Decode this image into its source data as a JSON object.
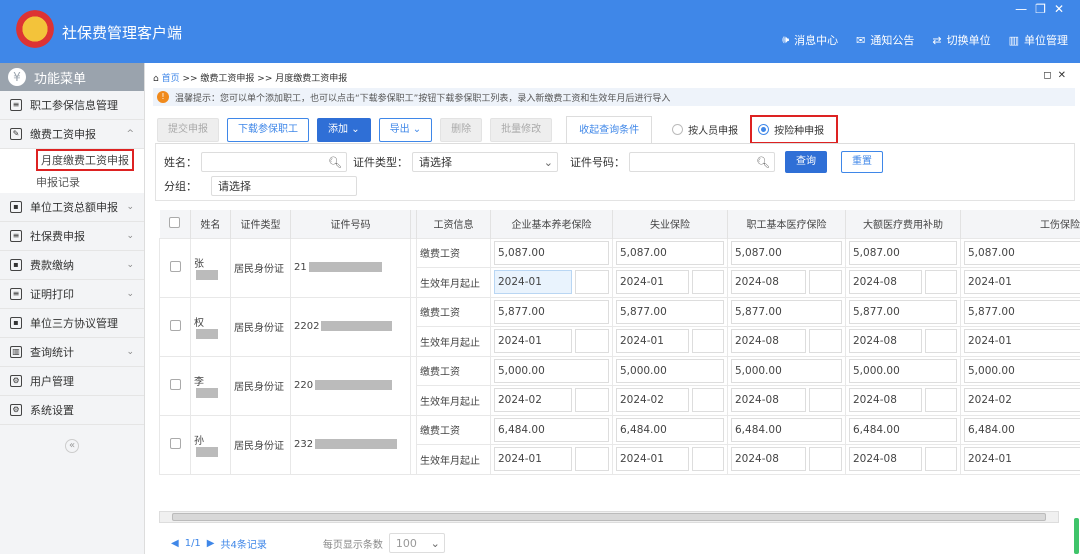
{
  "header": {
    "title": "社保费管理客户端",
    "window_controls": [
      "—",
      "❐",
      "✕"
    ],
    "nav": [
      {
        "icon": "speaker-icon",
        "glyph": "🕪",
        "label": "消息中心"
      },
      {
        "icon": "mail-icon",
        "glyph": "✉",
        "label": "通知公告"
      },
      {
        "icon": "switch-icon",
        "glyph": "⇄",
        "label": "切换单位"
      },
      {
        "icon": "building-icon",
        "glyph": "▥",
        "label": "单位管理"
      }
    ]
  },
  "sidebar": {
    "title": "功能菜单",
    "items": [
      {
        "label": "职工参保信息管理",
        "glyph": "≡"
      },
      {
        "label": "缴费工资申报",
        "glyph": "✎",
        "chev": "^",
        "subs": [
          "月度缴费工资申报",
          "申报记录"
        ]
      },
      {
        "label": "单位工资总额申报",
        "glyph": "▪",
        "chev": "⌄"
      },
      {
        "label": "社保费申报",
        "glyph": "≡",
        "chev": "⌄"
      },
      {
        "label": "费款缴纳",
        "glyph": "▪",
        "chev": "⌄"
      },
      {
        "label": "证明打印",
        "glyph": "≡",
        "chev": "⌄"
      },
      {
        "label": "单位三方协议管理",
        "glyph": "▪"
      },
      {
        "label": "查询统计",
        "glyph": "▥",
        "chev": "⌄"
      },
      {
        "label": "用户管理",
        "glyph": "⚙"
      },
      {
        "label": "系统设置",
        "glyph": "⚙"
      }
    ],
    "collapse": "«"
  },
  "breadcrumb": {
    "home": "首页",
    "sep": " >> ",
    "items": [
      "缴费工资申报",
      "月度缴费工资申报"
    ]
  },
  "tip": "温馨提示：您可以单个添加职工，也可以点击“下载参保职工”按钮下载参保职工列表，录入新缴费工资和生效年月后进行导入",
  "toolbar": {
    "submit": "提交申报",
    "download": "下载参保职工",
    "add": "添加",
    "export": "导出",
    "delete": "删除",
    "batch": "批量修改",
    "collapse_query": "收起查询条件",
    "radio_person": "按人员申报",
    "radio_insurance": "按险种申报"
  },
  "query": {
    "name_label": "姓名：",
    "name_value": "",
    "idtype_label": "证件类型：",
    "idtype_value": "请选择",
    "idno_label": "证件号码：",
    "idno_value": "",
    "group_label": "分组：",
    "group_value": "请选择",
    "search": "查询",
    "reset": "重置"
  },
  "table": {
    "headers": [
      "姓名",
      "证件类型",
      "证件号码",
      "工资信息",
      "企业基本养老保险",
      "失业保险",
      "职工基本医疗保险",
      "大额医疗费用补助",
      "工伤保险"
    ],
    "row_labels": [
      "缴费工资",
      "生效年月起止"
    ],
    "rows": [
      {
        "name": "张",
        "idtype": "居民身份证",
        "idno": "21",
        "wage": "5,087.00",
        "dates": [
          "2024-01",
          "2024-01",
          "2024-08",
          "2024-08",
          "2024-01"
        ]
      },
      {
        "name": "权",
        "idtype": "居民身份证",
        "idno": "2202",
        "wage": "5,877.00",
        "dates": [
          "2024-01",
          "2024-01",
          "2024-08",
          "2024-08",
          "2024-01"
        ]
      },
      {
        "name": "李",
        "idtype": "居民身份证",
        "idno": "220",
        "wage": "5,000.00",
        "dates": [
          "2024-02",
          "2024-02",
          "2024-08",
          "2024-08",
          "2024-02"
        ]
      },
      {
        "name": "孙",
        "idtype": "居民身份证",
        "idno": "232",
        "wage": "6,484.00",
        "dates": [
          "2024-01",
          "2024-01",
          "2024-08",
          "2024-08",
          "2024-01"
        ]
      }
    ]
  },
  "pager": {
    "page": "1/1",
    "total": "共4条记录",
    "per_page_label": "每页显示条数",
    "per_page": "100"
  }
}
